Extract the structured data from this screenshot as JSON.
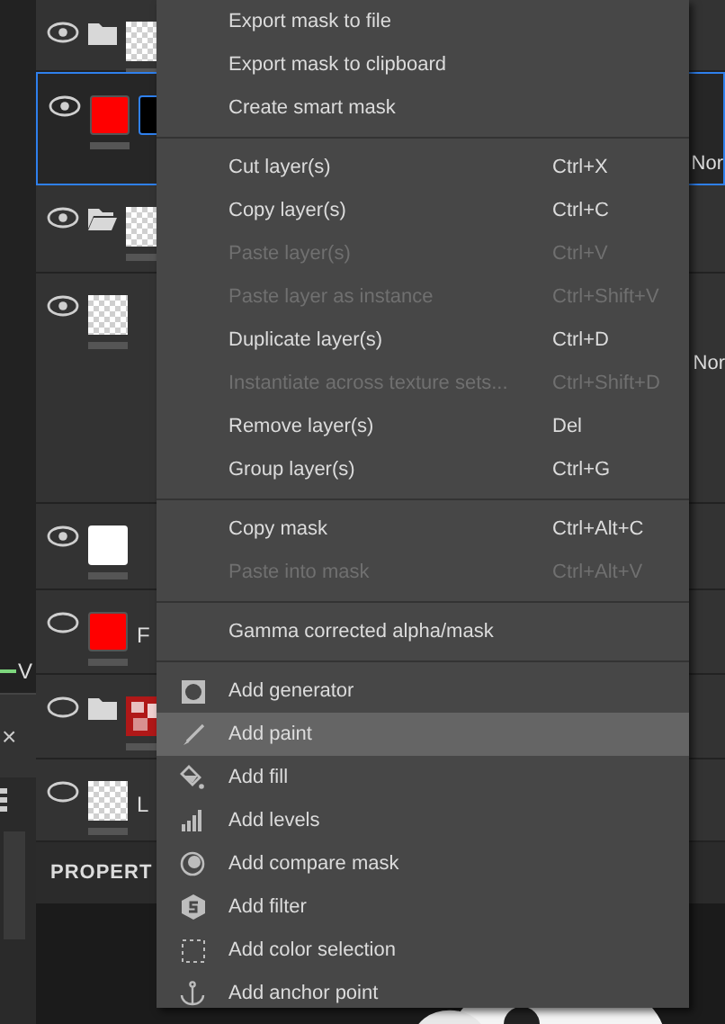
{
  "side_panel": {
    "channel_label": "V",
    "close": "×"
  },
  "layers": [
    {
      "visible": true,
      "selected": false,
      "folder": true,
      "folder_open": false,
      "kind": "checker"
    },
    {
      "visible": true,
      "selected": true,
      "folder": false,
      "kind": "paint",
      "blend": "Nor",
      "mask": true
    },
    {
      "visible": true,
      "selected": false,
      "folder": true,
      "folder_open": true,
      "kind": "checker"
    },
    {
      "visible": true,
      "selected": false,
      "folder": false,
      "kind": "checker",
      "blend": "Nor"
    },
    {
      "visible": true,
      "selected": false,
      "folder": false,
      "kind": "white"
    },
    {
      "visible": false,
      "selected": false,
      "folder": false,
      "kind": "paint",
      "label": "F"
    },
    {
      "visible": false,
      "selected": false,
      "folder": true,
      "folder_open": false,
      "kind": "texture"
    },
    {
      "visible": false,
      "selected": false,
      "folder": false,
      "kind": "checker",
      "label": "L"
    }
  ],
  "properties": {
    "title": "PROPERT"
  },
  "context_menu": {
    "sections": [
      [
        {
          "label": "Export mask to file",
          "disabled": false,
          "highlighted": false
        },
        {
          "label": "Export mask to clipboard",
          "disabled": false,
          "highlighted": false
        },
        {
          "label": "Create smart mask",
          "disabled": false,
          "highlighted": false
        }
      ],
      [
        {
          "label": "Cut layer(s)",
          "shortcut": "Ctrl+X",
          "disabled": false,
          "highlighted": false
        },
        {
          "label": "Copy layer(s)",
          "shortcut": "Ctrl+C",
          "disabled": false,
          "highlighted": false
        },
        {
          "label": "Paste layer(s)",
          "shortcut": "Ctrl+V",
          "disabled": true,
          "highlighted": false
        },
        {
          "label": "Paste layer as instance",
          "shortcut": "Ctrl+Shift+V",
          "disabled": true,
          "highlighted": false
        },
        {
          "label": "Duplicate layer(s)",
          "shortcut": "Ctrl+D",
          "disabled": false,
          "highlighted": false
        },
        {
          "label": "Instantiate across texture sets...",
          "shortcut": "Ctrl+Shift+D",
          "disabled": true,
          "highlighted": false
        },
        {
          "label": "Remove layer(s)",
          "shortcut": "Del",
          "disabled": false,
          "highlighted": false
        },
        {
          "label": "Group layer(s)",
          "shortcut": "Ctrl+G",
          "disabled": false,
          "highlighted": false
        }
      ],
      [
        {
          "label": "Copy mask",
          "shortcut": "Ctrl+Alt+C",
          "disabled": false,
          "highlighted": false
        },
        {
          "label": "Paste into mask",
          "shortcut": "Ctrl+Alt+V",
          "disabled": true,
          "highlighted": false
        }
      ],
      [
        {
          "label": "Gamma corrected alpha/mask",
          "disabled": false,
          "highlighted": false
        }
      ],
      [
        {
          "kind": "generator",
          "label": "Add generator",
          "disabled": false,
          "highlighted": false
        },
        {
          "kind": "paint",
          "label": "Add paint",
          "disabled": false,
          "highlighted": true
        },
        {
          "kind": "fill",
          "label": "Add fill",
          "disabled": false,
          "highlighted": false
        },
        {
          "kind": "levels",
          "label": "Add levels",
          "disabled": false,
          "highlighted": false
        },
        {
          "kind": "compare",
          "label": "Add compare mask",
          "disabled": false,
          "highlighted": false
        },
        {
          "kind": "filter",
          "label": "Add filter",
          "disabled": false,
          "highlighted": false
        },
        {
          "kind": "selection",
          "label": "Add color selection",
          "disabled": false,
          "highlighted": false
        },
        {
          "kind": "anchor",
          "label": "Add anchor point",
          "disabled": false,
          "highlighted": false
        }
      ]
    ]
  }
}
